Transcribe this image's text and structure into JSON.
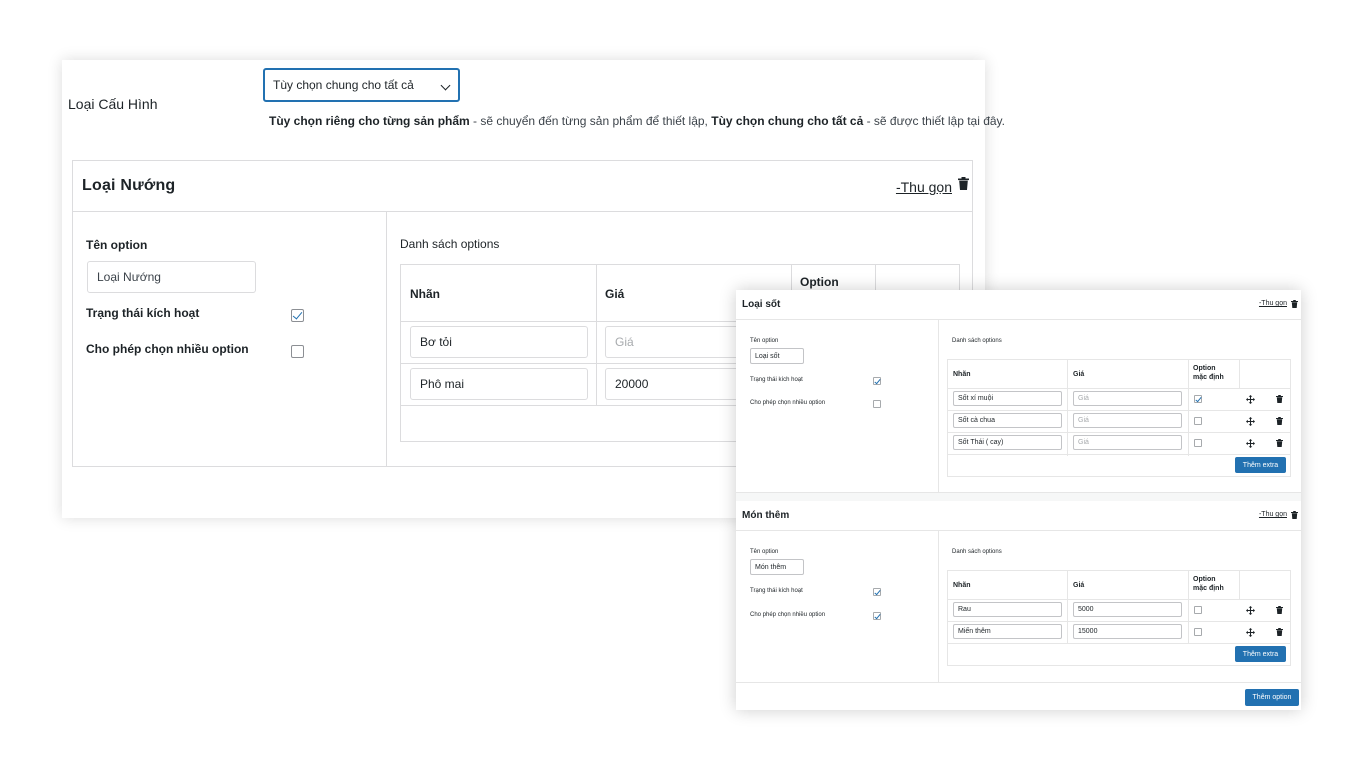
{
  "config": {
    "label": "Loại Cấu Hình",
    "select_value": "Tùy chọn chung cho tất cả",
    "hint_bold_1": "Tùy chọn riêng cho từng sản phẩm",
    "hint_text_1": " - sẽ chuyển đến từng sản phẩm để thiết lập, ",
    "hint_bold_2": "Tùy chọn chung cho tất cả",
    "hint_text_2": " - sẽ được thiết lập tại đây."
  },
  "group_main": {
    "title": "Loại Nướng",
    "collapse": "-Thu gọn",
    "name_label": "Tên option",
    "name_value": "Loại Nướng",
    "active_label": "Trạng thái kích hoạt",
    "multi_label": "Cho phép chọn nhiều option",
    "list_label": "Danh sách options",
    "col_label": "Nhãn",
    "col_price": "Giá",
    "col_option": "Option",
    "price_placeholder": "Giá",
    "rows": [
      {
        "label": "Bơ tỏi",
        "price": ""
      },
      {
        "label": "Phô mai",
        "price": "20000"
      }
    ]
  },
  "front": {
    "groups": [
      {
        "title": "Loại sốt",
        "collapse": "-Thu gọn",
        "name_label": "Tên option",
        "name_value": "Loại sốt",
        "active_label": "Trạng thái kích hoạt",
        "multi_label": "Cho phép chọn nhiều option",
        "list_label": "Danh sách options",
        "col_label": "Nhãn",
        "col_price": "Giá",
        "col_default_1": "Option",
        "col_default_2": "mặc định",
        "add_extra": "Thêm extra",
        "price_placeholder": "Giá",
        "rows": [
          {
            "label": "Sốt xí muội",
            "price": ""
          },
          {
            "label": "Sốt cà chua",
            "price": ""
          },
          {
            "label": "Sốt Thái ( cay)",
            "price": ""
          }
        ]
      },
      {
        "title": "Món thêm",
        "collapse": "-Thu gọn",
        "name_label": "Tên option",
        "name_value": "Món thêm",
        "active_label": "Trạng thái kích hoạt",
        "multi_label": "Cho phép chọn nhiều option",
        "list_label": "Danh sách options",
        "col_label": "Nhãn",
        "col_price": "Giá",
        "col_default_1": "Option",
        "col_default_2": "mặc định",
        "add_extra": "Thêm extra",
        "rows": [
          {
            "label": "Rau",
            "price": "5000"
          },
          {
            "label": "Miến thêm",
            "price": "15000"
          }
        ]
      }
    ],
    "add_option": "Thêm option"
  },
  "colors": {
    "accent": "#2271b1",
    "border": "#dcdcde",
    "text": "#1d2327"
  }
}
